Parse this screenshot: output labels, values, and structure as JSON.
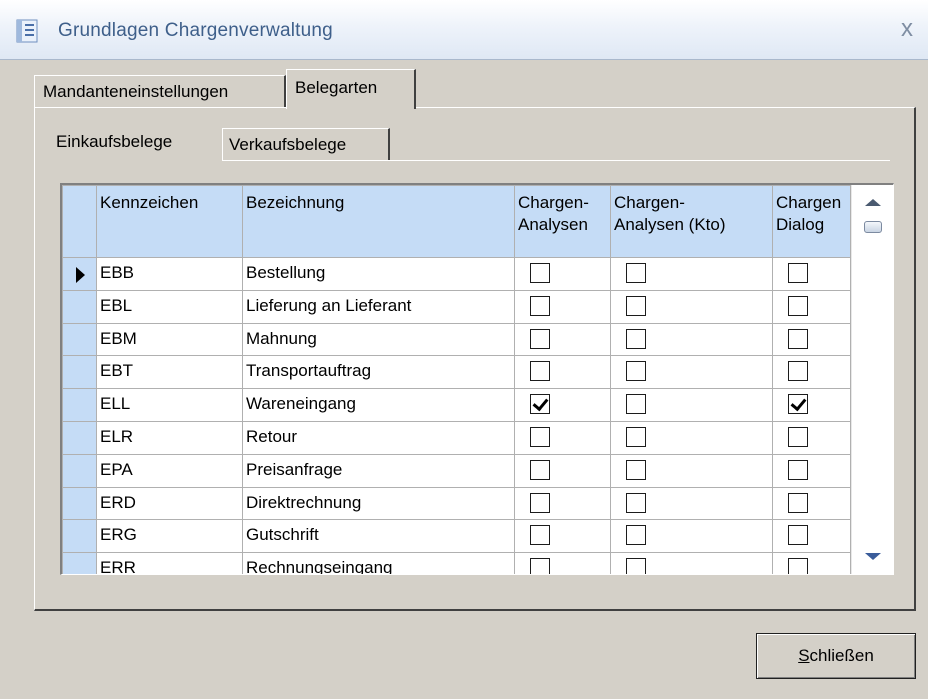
{
  "window": {
    "title": "Grundlagen Chargenverwaltung",
    "icon": "form-icon",
    "close_glyph": "x"
  },
  "outer_tabs": [
    {
      "label": "Mandanteneinstellungen",
      "selected": false
    },
    {
      "label": "Belegarten",
      "selected": true
    }
  ],
  "inner_tabs": [
    {
      "label": "Einkaufsbelege",
      "selected": true
    },
    {
      "label": "Verkaufsbelege",
      "selected": false
    }
  ],
  "grid": {
    "columns": [
      "Kennzeichen",
      "Bezeichnung",
      "Chargen-Analysen",
      "Chargen-Analysen (Kto)",
      "Chargen-Dialog"
    ],
    "header_lines": {
      "kennzeichen": "Kennzeichen",
      "bezeichnung": "Bezeichnung",
      "ca_1": "Chargen-",
      "ca_2": "Analysen",
      "cak_1": "Chargen-",
      "cak_2": "Analysen (Kto)",
      "cd_1": "Chargen",
      "cd_2": "Dialog"
    },
    "rows": [
      {
        "kennzeichen": "EBB",
        "bezeichnung": "Bestellung",
        "analysen": false,
        "analysen_kto": false,
        "dialog": false,
        "current": true
      },
      {
        "kennzeichen": "EBL",
        "bezeichnung": "Lieferung an Lieferant",
        "analysen": false,
        "analysen_kto": false,
        "dialog": false
      },
      {
        "kennzeichen": "EBM",
        "bezeichnung": "Mahnung",
        "analysen": false,
        "analysen_kto": false,
        "dialog": false
      },
      {
        "kennzeichen": "EBT",
        "bezeichnung": "Transportauftrag",
        "analysen": false,
        "analysen_kto": false,
        "dialog": false
      },
      {
        "kennzeichen": "ELL",
        "bezeichnung": "Wareneingang",
        "analysen": true,
        "analysen_kto": false,
        "dialog": true
      },
      {
        "kennzeichen": "ELR",
        "bezeichnung": "Retour",
        "analysen": false,
        "analysen_kto": false,
        "dialog": false
      },
      {
        "kennzeichen": "EPA",
        "bezeichnung": "Preisanfrage",
        "analysen": false,
        "analysen_kto": false,
        "dialog": false
      },
      {
        "kennzeichen": "ERD",
        "bezeichnung": "Direktrechnung",
        "analysen": false,
        "analysen_kto": false,
        "dialog": false
      },
      {
        "kennzeichen": "ERG",
        "bezeichnung": "Gutschrift",
        "analysen": false,
        "analysen_kto": false,
        "dialog": false
      },
      {
        "kennzeichen": "ERR",
        "bezeichnung": "Rechnungseingang",
        "analysen": false,
        "analysen_kto": false,
        "dialog": false
      }
    ]
  },
  "buttons": {
    "close_mnemonic": "S",
    "close_rest": "chließen"
  },
  "colors": {
    "title_text": "#3e5f8a",
    "header_bg": "#c5dcf6",
    "dialog_bg": "#d4d0c8"
  }
}
